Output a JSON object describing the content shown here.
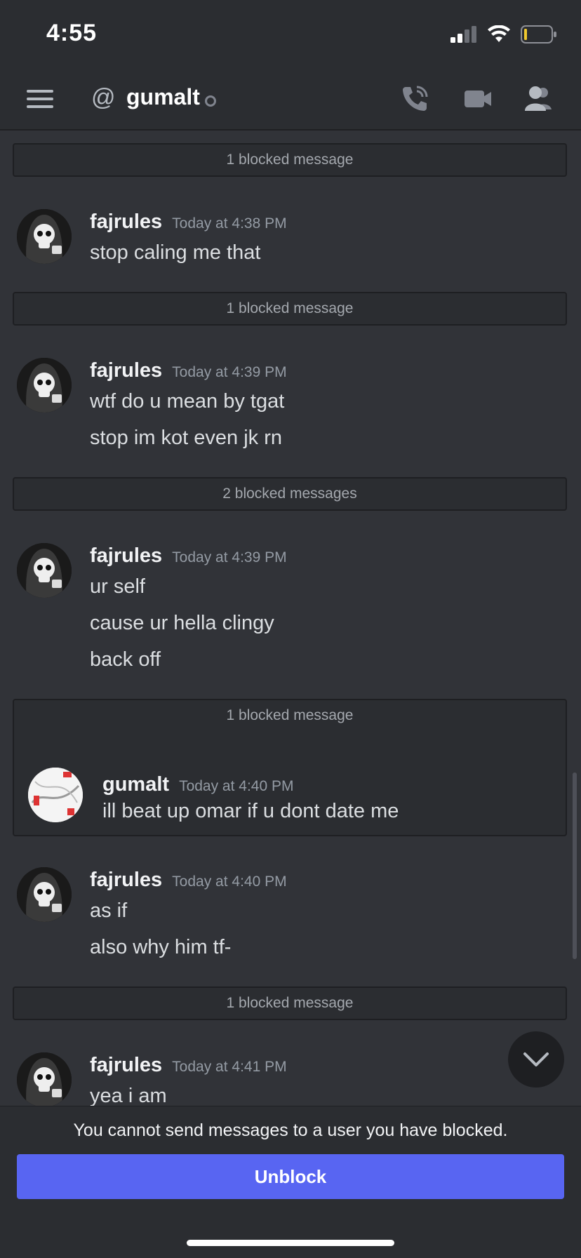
{
  "status_bar": {
    "time": "4:55"
  },
  "header": {
    "at_symbol": "@",
    "title": "gumalt",
    "icons": [
      "menu-icon",
      "call-icon",
      "video-icon",
      "members-icon"
    ]
  },
  "feed": {
    "blocked_1": "1 blocked message",
    "msg1": {
      "author": "fajrules",
      "timestamp": "Today at 4:38 PM",
      "lines": [
        "stop caling me that"
      ]
    },
    "blocked_2": "1 blocked message",
    "msg2": {
      "author": "fajrules",
      "timestamp": "Today at 4:39 PM",
      "lines": [
        "wtf do u mean by tgat",
        "stop im kot even jk rn"
      ]
    },
    "blocked_3": "2 blocked messages",
    "msg3": {
      "author": "fajrules",
      "timestamp": "Today at 4:39 PM",
      "lines": [
        "ur self",
        "cause ur hella clingy",
        "back off"
      ]
    },
    "blocked_4": "1 blocked message",
    "blocked_msg": {
      "author": "gumalt",
      "timestamp": "Today at 4:40 PM",
      "lines": [
        "ill beat up omar if u dont date me"
      ]
    },
    "msg4": {
      "author": "fajrules",
      "timestamp": "Today at 4:40 PM",
      "lines": [
        "as if",
        "also why him tf-"
      ]
    },
    "blocked_5": "1 blocked message",
    "msg5": {
      "author": "fajrules",
      "timestamp": "Today at 4:41 PM",
      "lines": [
        "yea i am"
      ]
    }
  },
  "composer": {
    "notice": "You cannot send messages to a user you have blocked.",
    "unblock_label": "Unblock"
  },
  "colors": {
    "accent": "#5865f2",
    "background": "#313338",
    "header": "#2b2d31"
  }
}
